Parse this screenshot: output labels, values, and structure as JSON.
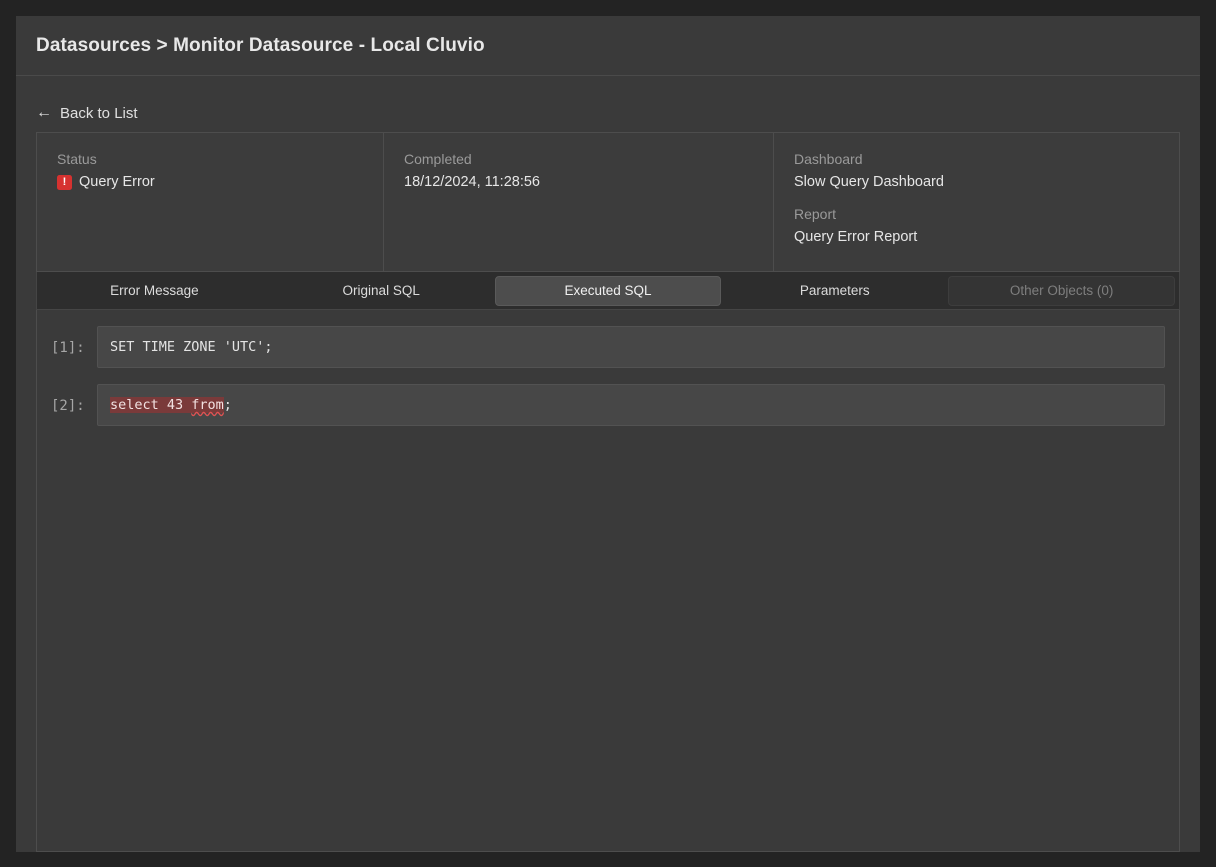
{
  "window": {
    "title": "Datasources > Monitor Datasource - Local Cluvio"
  },
  "nav": {
    "back_label": "Back to List",
    "back_icon": "arrow-left-icon"
  },
  "info_card": {
    "status": {
      "label": "Status",
      "value": "Query Error",
      "icon": "error-exclamation-icon",
      "icon_glyph": "!",
      "icon_color": "#d63230"
    },
    "completed": {
      "label": "Completed",
      "value": "18/12/2024, 11:28:56"
    },
    "dashboard": {
      "label": "Dashboard",
      "value": "Slow Query Dashboard"
    },
    "report": {
      "label": "Report",
      "value": "Query Error Report"
    }
  },
  "tabs": [
    {
      "label": "Error Message",
      "active": false,
      "disabled": false
    },
    {
      "label": "Original SQL",
      "active": false,
      "disabled": false
    },
    {
      "label": "Executed SQL",
      "active": true,
      "disabled": false
    },
    {
      "label": "Parameters",
      "active": false,
      "disabled": false
    },
    {
      "label": "Other Objects (0)",
      "active": false,
      "disabled": true
    }
  ],
  "sql": {
    "statements": [
      {
        "gutter": "[1]:",
        "prefix": "",
        "error_text": "",
        "error_tail": "",
        "suffix": "SET TIME ZONE 'UTC';"
      },
      {
        "gutter": "[2]:",
        "prefix": "",
        "error_text": "select 43 ",
        "error_tail": "from",
        "suffix": ";"
      }
    ]
  },
  "colors": {
    "page_background": "#232323",
    "modal_background": "#3a3a3a",
    "code_background": "#474747",
    "error_highlight": "#7a3a3a",
    "squiggle": "#e05252",
    "accent_error": "#d63230"
  }
}
